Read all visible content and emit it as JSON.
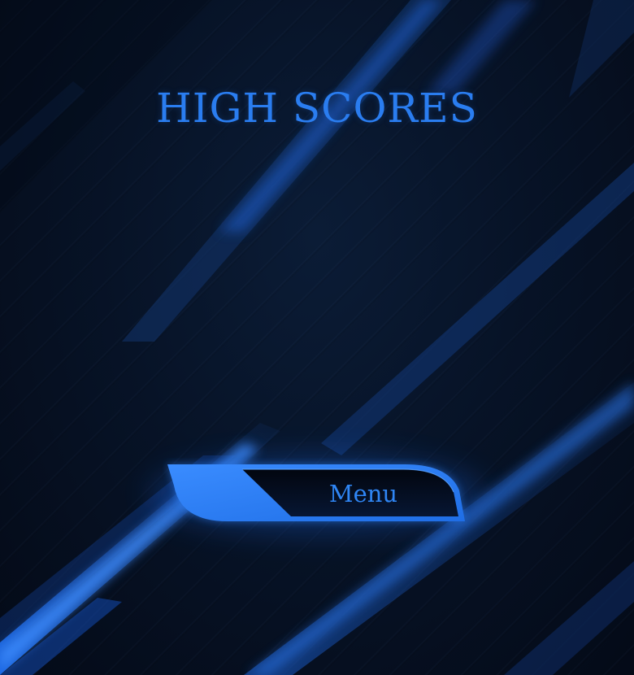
{
  "screen": {
    "title": "HIGH SCORES"
  },
  "menu_button": {
    "label": "Menu"
  },
  "colors": {
    "background": "#050d1c",
    "accent": "#2a7df0",
    "button_fill": "#2b7ff0",
    "button_dark": "#040b18"
  }
}
